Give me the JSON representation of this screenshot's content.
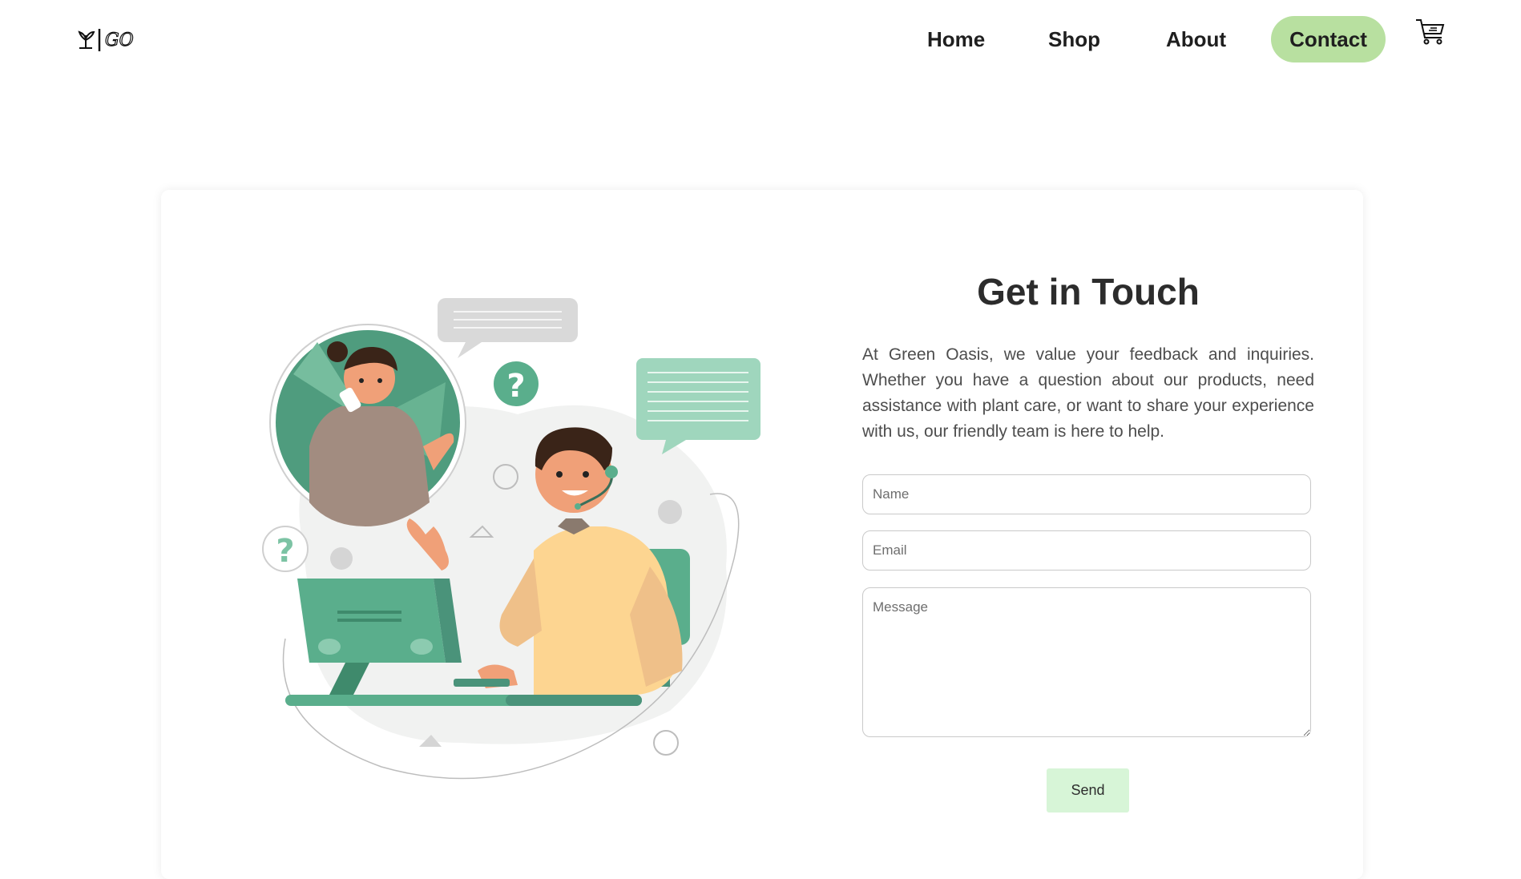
{
  "brand": {
    "logo_text": "GO",
    "name": "Green Oasis"
  },
  "nav": {
    "items": [
      "Home",
      "Shop",
      "About",
      "Contact"
    ],
    "active": "Contact"
  },
  "colors": {
    "accent": "#b8e0a0",
    "send_button": "#d7f5d7",
    "illustration_green": "#5aae8c"
  },
  "icons": {
    "cart": "cart-icon",
    "logo": "plant-logo-icon"
  },
  "contact": {
    "title": "Get in Touch",
    "intro": "At Green Oasis, we value your feedback and inquiries. Whether you have a question about our products, need assistance with plant care, or want to share your experience with us, our friendly team is here to help.",
    "fields": {
      "name_placeholder": "Name",
      "email_placeholder": "Email",
      "message_placeholder": "Message"
    },
    "send_label": "Send"
  }
}
